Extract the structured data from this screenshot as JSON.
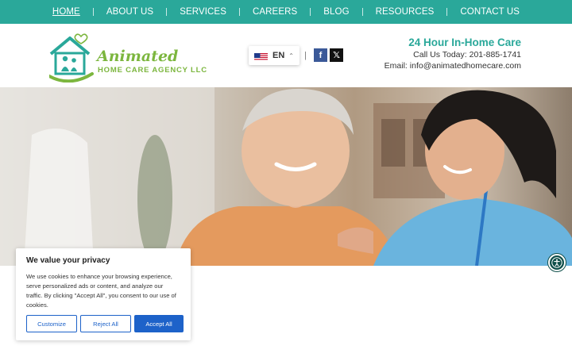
{
  "nav": {
    "items": [
      {
        "label": "HOME"
      },
      {
        "label": "ABOUT US"
      },
      {
        "label": "SERVICES"
      },
      {
        "label": "CAREERS"
      },
      {
        "label": "BLOG"
      },
      {
        "label": "RESOURCES"
      },
      {
        "label": "CONTACT US"
      }
    ],
    "active": "HOME"
  },
  "brand": {
    "name": "Animated",
    "tagline": "HOME CARE AGENCY LLC"
  },
  "language": {
    "code": "EN",
    "flag": "us-flag-icon"
  },
  "social": {
    "facebook_icon": "facebook-icon",
    "x_icon": "x-twitter-icon",
    "facebook_glyph": "f",
    "x_glyph": "𝕏"
  },
  "contact": {
    "headline": "24 Hour In-Home Care",
    "phone_label": "Call Us Today:",
    "phone": "201-885-1741",
    "email_label": "Email:",
    "email": "info@animatedhomecare.com"
  },
  "cookie_banner": {
    "title": "We value your privacy",
    "text": "We use cookies to enhance your browsing experience, serve personalized ads or content, and analyze our traffic. By clicking \"Accept All\", you consent to our use of cookies.",
    "customize_label": "Customize",
    "reject_label": "Reject All",
    "accept_label": "Accept All"
  },
  "colors": {
    "nav_bg": "#2aa89a",
    "brand_green": "#7cb63e",
    "teal": "#2aa89a",
    "button_blue": "#1d62c9"
  }
}
